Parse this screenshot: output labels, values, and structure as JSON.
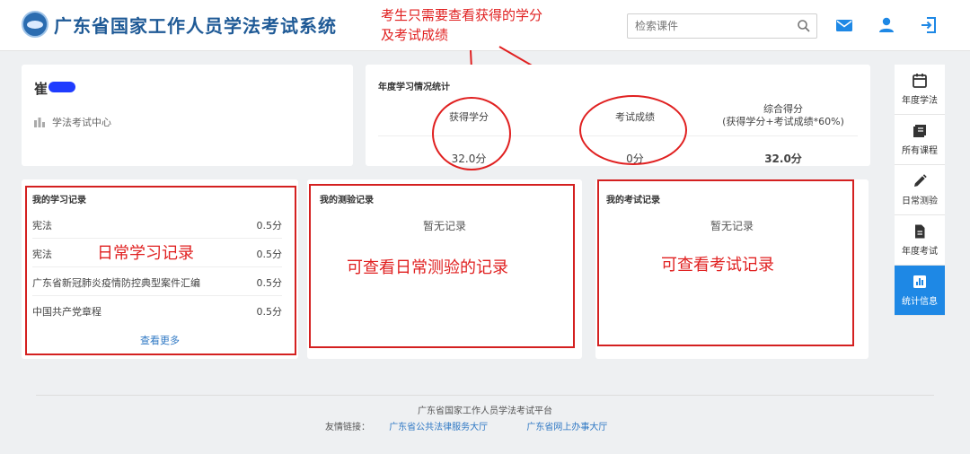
{
  "header": {
    "site_title": "广东省国家工作人员学法考试系统",
    "search_placeholder": "检索课件",
    "icons": [
      "mail-icon",
      "user-icon",
      "logout-icon"
    ],
    "accent": "#1e88e5"
  },
  "annotations": {
    "top_line1": "考生只需要查看获得的学分",
    "top_line2": "及考试成绩",
    "study_records": "日常学习记录",
    "quiz_records": "可查看日常测验的记录",
    "exam_records": "可查看考试记录",
    "color": "#e02020"
  },
  "user": {
    "name": "崔",
    "center_link": "学法考试中心"
  },
  "stats": {
    "title": "年度学习情况统计",
    "earned_label": "获得学分",
    "earned_value": "32.0分",
    "exam_label": "考试成绩",
    "exam_value": "0分",
    "total_label_1": "综合得分",
    "total_label_2": "(获得学分+考试成绩*60%)",
    "total_value": "32.0分"
  },
  "study_records": {
    "title": "我的学习记录",
    "rows": [
      {
        "name": "宪法",
        "value": "0.5分"
      },
      {
        "name": "宪法",
        "value": "0.5分"
      },
      {
        "name": "广东省新冠肺炎疫情防控典型案件汇编",
        "value": "0.5分"
      },
      {
        "name": "中国共产党章程",
        "value": "0.5分"
      }
    ],
    "more": "查看更多"
  },
  "quiz_records": {
    "title": "我的测验记录",
    "empty": "暂无记录"
  },
  "exam_records": {
    "title": "我的考试记录",
    "empty": "暂无记录"
  },
  "side_nav": [
    {
      "label": "年度学法",
      "icon": "calendar-icon",
      "active": false
    },
    {
      "label": "所有课程",
      "icon": "book-icon",
      "active": false
    },
    {
      "label": "日常测验",
      "icon": "pencil-icon",
      "active": false
    },
    {
      "label": "年度考试",
      "icon": "document-icon",
      "active": false
    },
    {
      "label": "统计信息",
      "icon": "chart-icon",
      "active": true
    }
  ],
  "footer": {
    "platform": "广东省国家工作人员学法考试平台",
    "links_label": "友情链接：",
    "link1": "广东省公共法律服务大厅",
    "link2": "广东省网上办事大厅"
  }
}
